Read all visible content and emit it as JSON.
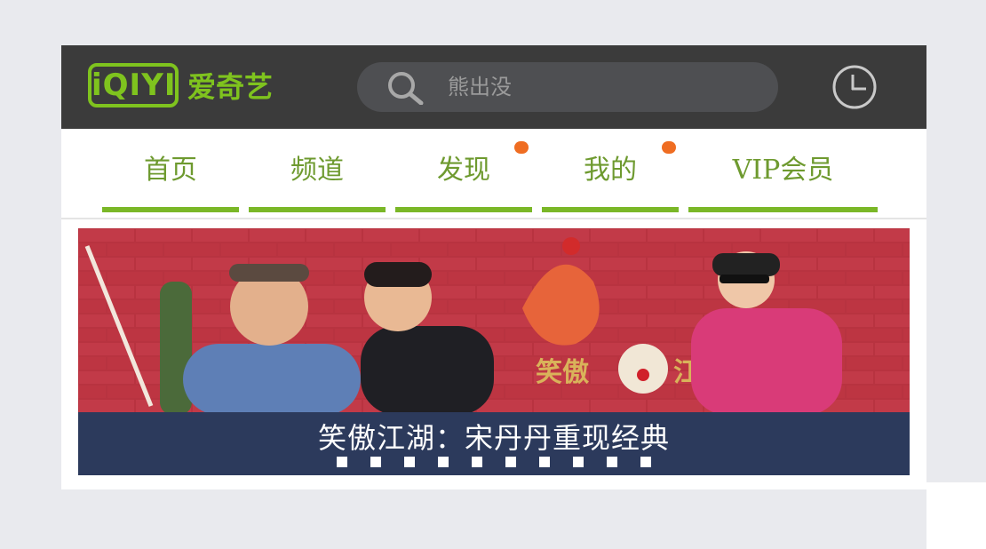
{
  "header": {
    "logo_mark": "iQIYI",
    "logo_text": "爱奇艺",
    "search": {
      "placeholder": "熊出没"
    }
  },
  "nav": {
    "tabs": [
      {
        "label": "首页",
        "badge": false
      },
      {
        "label": "频道",
        "badge": false
      },
      {
        "label": "发现",
        "badge": true
      },
      {
        "label": "我的",
        "badge": true
      },
      {
        "label": "VIP会员",
        "badge": false
      }
    ]
  },
  "banner": {
    "caption": "笑傲江湖：宋丹丹重现经典",
    "overlay_title": "笑傲江湖",
    "slide_count": 10
  },
  "colors": {
    "header_bg": "#3b3b3b",
    "brand_green": "#7fc31e",
    "badge_orange": "#ef6d22",
    "caption_bar": "#2c3a5c"
  }
}
